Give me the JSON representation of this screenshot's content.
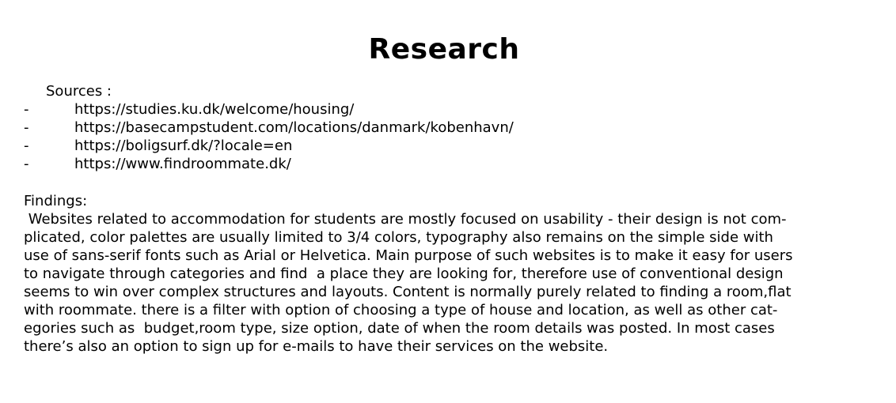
{
  "title": "Research",
  "sources": {
    "label": "Sources :",
    "bullet": "-",
    "items": [
      "https://studies.ku.dk/welcome/housing/",
      "https://basecampstudent.com/locations/danmark/kobenhavn/",
      "https://boligsurf.dk/?locale=en",
      "https://www.findroommate.dk/"
    ]
  },
  "findings": {
    "label": "Findings:",
    "lines": [
      " Websites related to accommodation for students are mostly focused on usability - their design is not com-",
      "plicated, color palettes are usually limited to 3/4 colors, typography also remains on the simple side with",
      "use of sans-serif fonts such as Arial or Helvetica. Main purpose of such websites is to make it easy for users",
      "to navigate through categories and find  a place they are looking for, therefore use of conventional design",
      "seems to win over complex structures and layouts. Content is normally purely related to finding a room,flat",
      "with roommate. there is a filter with option of choosing a type of house and location, as well as other cat-",
      "egories such as  budget,room type, size option, date of when the room details was posted. In most cases",
      "there’s also an option to sign up for e-mails to have their services on the website."
    ]
  }
}
